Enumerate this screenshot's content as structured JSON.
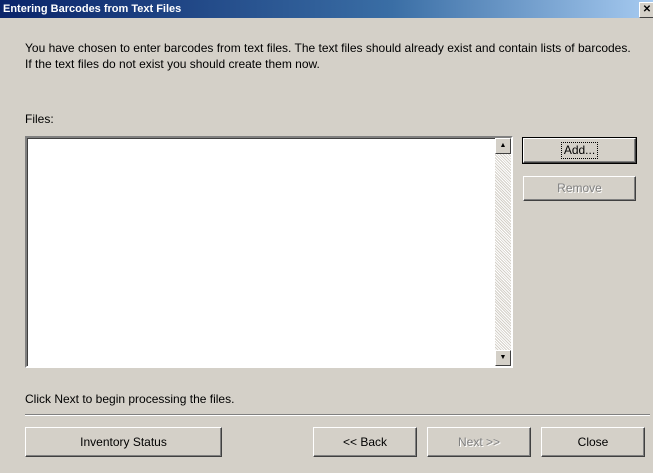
{
  "window": {
    "title": "Entering Barcodes from Text Files",
    "close_glyph": "✕"
  },
  "intro": {
    "text": "You have chosen to enter barcodes from text files.  The text files should already exist and contain lists of barcodes.  If the text files do not exist you should create them now."
  },
  "files": {
    "label": "Files:",
    "items": []
  },
  "scrollbar": {
    "up_glyph": "▲",
    "down_glyph": "▼"
  },
  "buttons": {
    "add": "Add...",
    "remove": "Remove",
    "inventory_status": "Inventory Status",
    "back": "<< Back",
    "next": "Next >>",
    "close": "Close"
  },
  "hint": "Click Next to begin processing the files."
}
